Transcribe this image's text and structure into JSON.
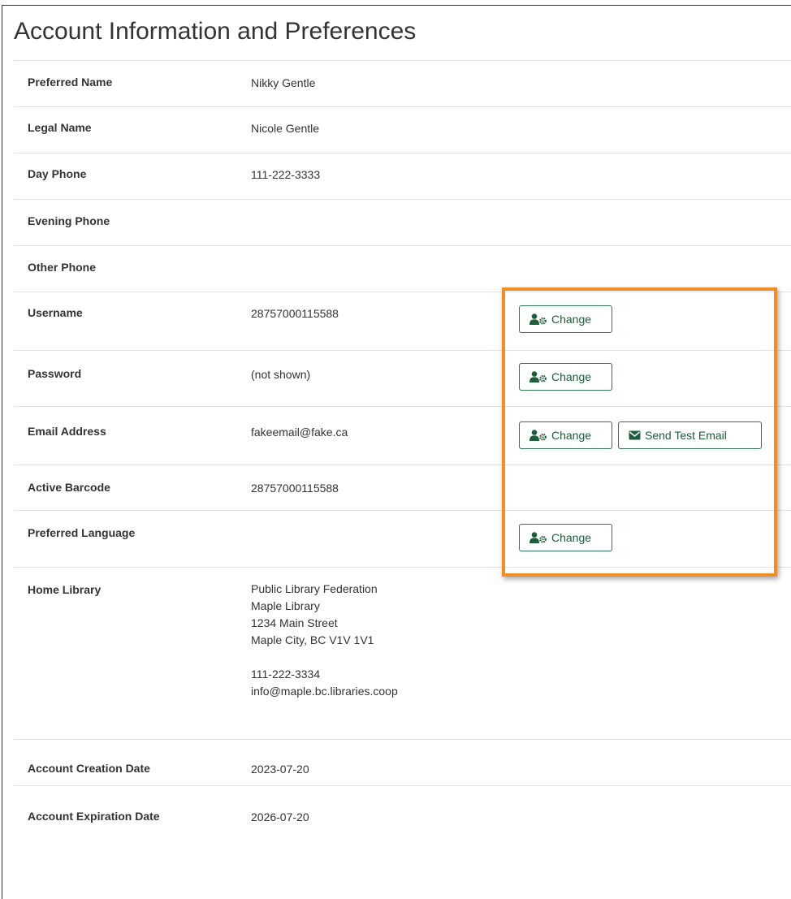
{
  "title": "Account Information and Preferences",
  "rows": [
    {
      "label": "Preferred Name",
      "value": "Nikky Gentle"
    },
    {
      "label": "Legal Name",
      "value": "Nicole Gentle"
    },
    {
      "label": "Day Phone",
      "value": "111-222-3333"
    },
    {
      "label": "Evening Phone",
      "value": ""
    },
    {
      "label": "Other Phone",
      "value": ""
    },
    {
      "label": "Username",
      "value": "28757000115588"
    },
    {
      "label": "Password",
      "value": "(not shown)"
    },
    {
      "label": "Email Address",
      "value": "fakeemail@fake.ca"
    },
    {
      "label": "Active Barcode",
      "value": "28757000115588"
    },
    {
      "label": "Preferred Language",
      "value": ""
    },
    {
      "label": "Home Library",
      "lines": [
        "Public Library Federation",
        "Maple Library",
        "1234 Main Street",
        "Maple City, BC V1V 1V1",
        "111-222-3334",
        "info@maple.bc.libraries.coop"
      ]
    },
    {
      "label": "Account Creation Date",
      "value": "2023-07-20"
    },
    {
      "label": "Account Expiration Date",
      "value": "2026-07-20"
    }
  ],
  "buttons": {
    "change_label": "Change",
    "send_test_email_label": "Send Test Email"
  },
  "icons": {
    "change": "user-gear-icon",
    "send_test_email": "envelope-icon"
  },
  "colors": {
    "button_border": "#2a7a4f",
    "button_text": "#1e5d3a",
    "highlight": "#f28c28"
  }
}
